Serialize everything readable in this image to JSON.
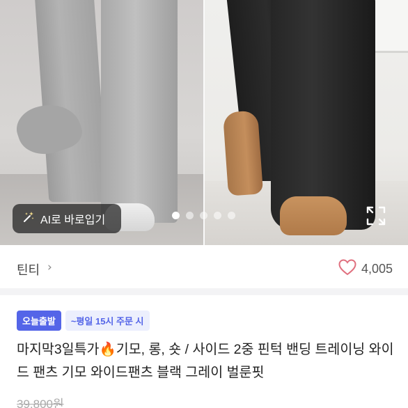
{
  "hero": {
    "ai_button_label": "AI로 바로입기",
    "ai_icon": "magic-wand-icon",
    "expand_icon": "expand-icon",
    "page_indicator": {
      "total": 5,
      "active_index": 0
    }
  },
  "shop": {
    "name": "틴티",
    "chevron": "›",
    "like_icon": "heart-icon",
    "like_count": "4,005"
  },
  "product": {
    "badge_today": "오늘출발",
    "badge_cutoff": "~평일 15시 주문 시",
    "title": "마지막3일특가🔥기모, 롱, 숏 / 사이드 2중 핀턱 밴딩 트레이닝 와이드 팬츠 기모 와이드팬츠 블랙 그레이 벌룬핏",
    "original_price": "39,800원"
  },
  "colors": {
    "accent": "#5465e8",
    "heart": "#e0707f"
  }
}
